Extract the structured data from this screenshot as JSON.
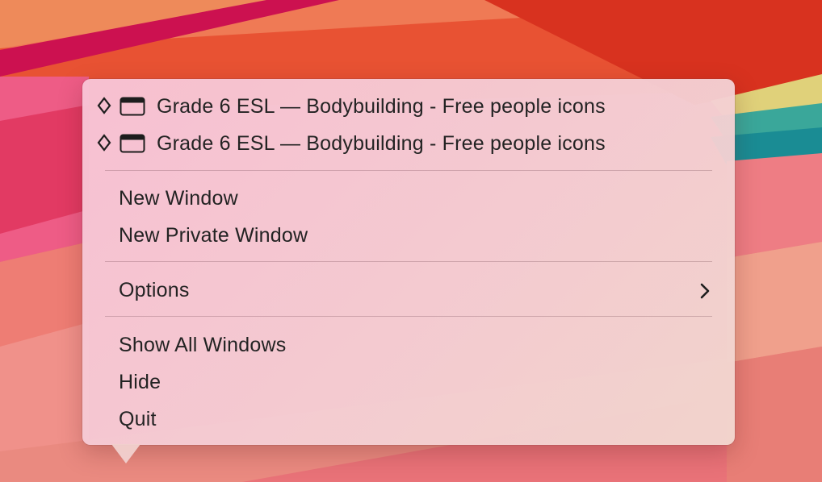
{
  "menu": {
    "window_items": [
      {
        "label": "Grade 6 ESL — Bodybuilding - Free people icons",
        "icon": "diamond-icon"
      },
      {
        "label": "Grade 6 ESL — Bodybuilding - Free people icons",
        "icon": "diamond-icon"
      }
    ],
    "new_window": "New Window",
    "new_private_window": "New Private Window",
    "options": "Options",
    "show_all_windows": "Show All Windows",
    "hide": "Hide",
    "quit": "Quit"
  },
  "colors": {
    "text": "#232323",
    "menu_bg": "#f4cdd6"
  }
}
